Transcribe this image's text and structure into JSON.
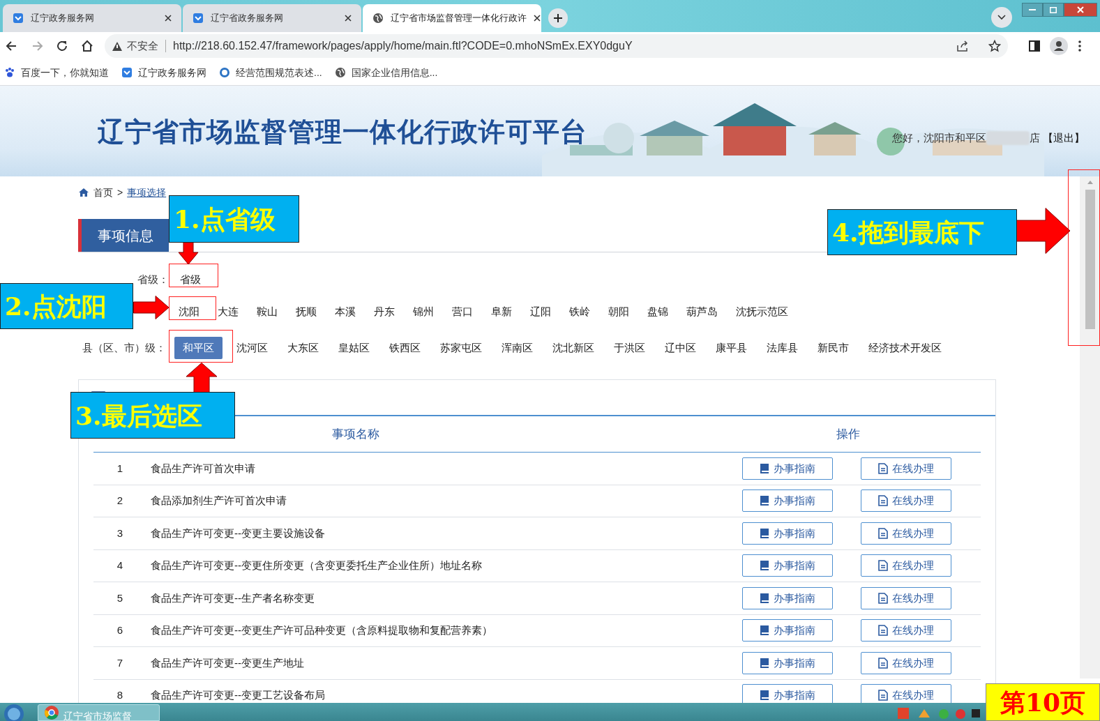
{
  "browser": {
    "tabs": [
      {
        "title": "辽宁政务服务网",
        "selected": false
      },
      {
        "title": "辽宁省政务服务网",
        "selected": false
      },
      {
        "title": "辽宁省市场监督管理一体化行政许",
        "selected": true
      }
    ],
    "address": {
      "security": "不安全",
      "url": "http://218.60.152.47/framework/pages/apply/home/main.ftl?CODE=0.mhoNSmEx.EXY0dguY"
    },
    "bookmarks": [
      {
        "label": "百度一下，你就知道"
      },
      {
        "label": "辽宁政务服务网"
      },
      {
        "label": "经营范围规范表述..."
      },
      {
        "label": "国家企业信用信息..."
      }
    ]
  },
  "header": {
    "title": "辽宁省市场监督管理一体化行政许可平台",
    "greeting": "您好，沈阳市和平区",
    "greeting_end": "店",
    "logout": "【退出】"
  },
  "breadcrumb": [
    "首页",
    ">",
    "事项选择"
  ],
  "section_tab": "事项信息",
  "province": {
    "label": "省级：",
    "options": [
      {
        "label": "省级",
        "selected": false
      }
    ]
  },
  "cities": [
    {
      "label": "沈阳",
      "selected": false
    },
    {
      "label": "大连",
      "selected": false
    },
    {
      "label": "鞍山",
      "selected": false
    },
    {
      "label": "抚顺",
      "selected": false
    },
    {
      "label": "本溪",
      "selected": false
    },
    {
      "label": "丹东",
      "selected": false
    },
    {
      "label": "锦州",
      "selected": false
    },
    {
      "label": "营口",
      "selected": false
    },
    {
      "label": "阜新",
      "selected": false
    },
    {
      "label": "辽阳",
      "selected": false
    },
    {
      "label": "铁岭",
      "selected": false
    },
    {
      "label": "朝阳",
      "selected": false
    },
    {
      "label": "盘锦",
      "selected": false
    },
    {
      "label": "葫芦岛",
      "selected": false
    },
    {
      "label": "沈抚示范区",
      "selected": false
    }
  ],
  "districts": {
    "label": "县（区、市）级：",
    "options": [
      {
        "label": "和平区",
        "selected": true
      },
      {
        "label": "沈河区",
        "selected": false
      },
      {
        "label": "大东区",
        "selected": false
      },
      {
        "label": "皇姑区",
        "selected": false
      },
      {
        "label": "铁西区",
        "selected": false
      },
      {
        "label": "苏家屯区",
        "selected": false
      },
      {
        "label": "浑南区",
        "selected": false
      },
      {
        "label": "沈北新区",
        "selected": false
      },
      {
        "label": "于洪区",
        "selected": false
      },
      {
        "label": "辽中区",
        "selected": false
      },
      {
        "label": "康平县",
        "selected": false
      },
      {
        "label": "法库县",
        "selected": false
      },
      {
        "label": "新民市",
        "selected": false
      },
      {
        "label": "经济技术开发区",
        "selected": false
      }
    ]
  },
  "card": {
    "columns": {
      "name": "事项名称",
      "actions": "操作"
    },
    "rows": [
      {
        "no": "1",
        "name": "食品生产许可首次申请",
        "actions": [
          {
            "label": "办事指南",
            "kind": "guide"
          },
          {
            "label": "在线办理",
            "kind": "online"
          }
        ]
      },
      {
        "no": "2",
        "name": "食品添加剂生产许可首次申请",
        "actions": [
          {
            "label": "办事指南",
            "kind": "guide"
          },
          {
            "label": "在线办理",
            "kind": "online"
          }
        ]
      },
      {
        "no": "3",
        "name": "食品生产许可变更--变更主要设施设备",
        "actions": [
          {
            "label": "办事指南",
            "kind": "guide"
          },
          {
            "label": "在线办理",
            "kind": "online"
          }
        ]
      },
      {
        "no": "4",
        "name": "食品生产许可变更--变更住所变更（含变更委托生产企业住所）地址名称",
        "actions": [
          {
            "label": "办事指南",
            "kind": "guide"
          },
          {
            "label": "在线办理",
            "kind": "online"
          }
        ]
      },
      {
        "no": "5",
        "name": "食品生产许可变更--生产者名称变更",
        "actions": [
          {
            "label": "办事指南",
            "kind": "guide"
          },
          {
            "label": "在线办理",
            "kind": "online"
          }
        ]
      },
      {
        "no": "6",
        "name": "食品生产许可变更--变更生产许可品种变更（含原料提取物和复配营养素）",
        "actions": [
          {
            "label": "办事指南",
            "kind": "guide"
          },
          {
            "label": "在线办理",
            "kind": "online"
          }
        ]
      },
      {
        "no": "7",
        "name": "食品生产许可变更--变更生产地址",
        "actions": [
          {
            "label": "办事指南",
            "kind": "guide"
          },
          {
            "label": "在线办理",
            "kind": "online"
          }
        ]
      },
      {
        "no": "8",
        "name": "食品生产许可变更--变更工艺设备布局",
        "actions": [
          {
            "label": "办事指南",
            "kind": "guide"
          },
          {
            "label": "在线办理",
            "kind": "online"
          }
        ]
      }
    ]
  },
  "callouts": [
    {
      "text": "1.点省级"
    },
    {
      "text": "2.点沈阳"
    },
    {
      "text": "3.最后选区"
    },
    {
      "text": "4.拖到最底下"
    }
  ],
  "page_label": "第10页",
  "taskbar": {
    "app": "辽宁省市场监督"
  }
}
